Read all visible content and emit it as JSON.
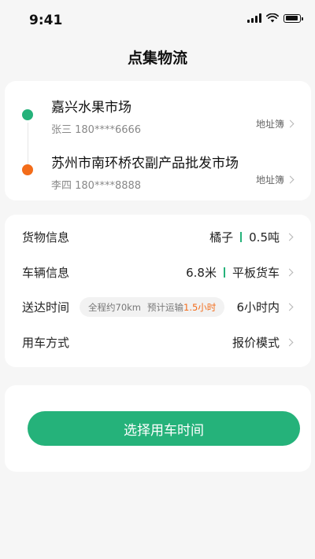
{
  "status_bar": {
    "time": "9:41"
  },
  "header": {
    "title": "点集物流"
  },
  "addresses": {
    "from": {
      "name": "嘉兴水果市场",
      "contact": "张三 180****6666",
      "book_label": "地址簿",
      "color": "#25b27a"
    },
    "to": {
      "name": "苏州市南环桥农副产品批发市场",
      "contact": "李四 180****8888",
      "book_label": "地址簿",
      "color": "#f36c1a"
    }
  },
  "details": {
    "goods": {
      "label": "货物信息",
      "value1": "橘子",
      "value2": "0.5吨"
    },
    "vehicle": {
      "label": "车辆信息",
      "value1": "6.8米",
      "value2": "平板货车"
    },
    "delivery": {
      "label": "送达时间",
      "distance": "全程约70km",
      "eta_prefix": "预计运输",
      "eta_value": "1.5小时",
      "value": "6小时内"
    },
    "mode": {
      "label": "用车方式",
      "value": "报价模式"
    }
  },
  "action": {
    "button_label": "选择用车时间"
  },
  "colors": {
    "accent": "#25b27a",
    "orange": "#f36c1a",
    "background": "#f6f6f6"
  },
  "icons": [
    "signal-icon",
    "wifi-icon",
    "battery-icon",
    "chevron-right-icon"
  ]
}
